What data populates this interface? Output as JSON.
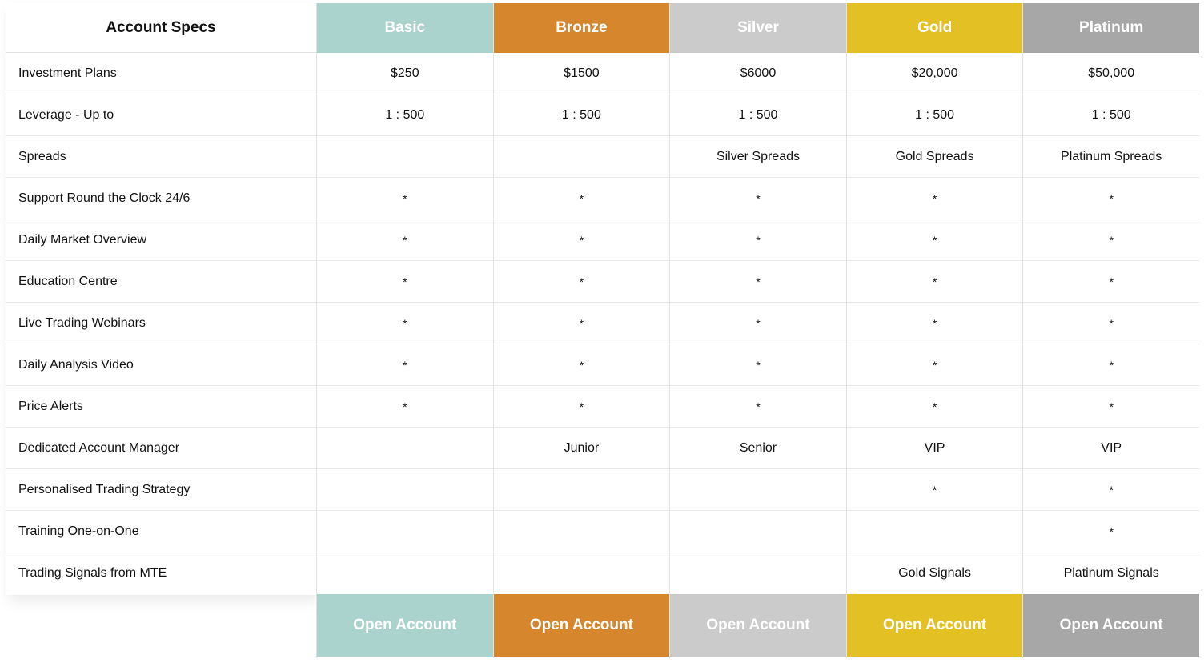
{
  "specs_title": "Account Specs",
  "features": [
    "Investment Plans",
    "Leverage - Up to",
    "Spreads",
    "Support Round the Clock 24/6",
    "Daily Market Overview",
    "Education Centre",
    "Live Trading Webinars",
    "Daily Analysis Video",
    "Price Alerts",
    "Dedicated Account Manager",
    "Personalised Trading Strategy",
    "Training One-on-One",
    "Trading Signals from MTE"
  ],
  "plans": [
    {
      "name": "Basic",
      "color": "#abd3ce",
      "button_label": "Open Account",
      "values": [
        "$250",
        "1 : 500",
        "",
        "*",
        "*",
        "*",
        "*",
        "*",
        "*",
        "",
        "",
        "",
        ""
      ]
    },
    {
      "name": "Bronze",
      "color": "#d6862c",
      "button_label": "Open Account",
      "values": [
        "$1500",
        "1 : 500",
        "",
        "*",
        "*",
        "*",
        "*",
        "*",
        "*",
        "Junior",
        "",
        "",
        ""
      ]
    },
    {
      "name": "Silver",
      "color": "#cbcbcb",
      "button_label": "Open Account",
      "values": [
        "$6000",
        "1 : 500",
        "Silver Spreads",
        "*",
        "*",
        "*",
        "*",
        "*",
        "*",
        "Senior",
        "",
        "",
        ""
      ]
    },
    {
      "name": "Gold",
      "color": "#e3c024",
      "button_label": "Open Account",
      "values": [
        "$20,000",
        "1 : 500",
        "Gold Spreads",
        "*",
        "*",
        "*",
        "*",
        "*",
        "*",
        "VIP",
        "*",
        "",
        "Gold Signals"
      ]
    },
    {
      "name": "Platinum",
      "color": "#a7a7a7",
      "button_label": "Open Account",
      "values": [
        "$50,000",
        "1 : 500",
        "Platinum Spreads",
        "*",
        "*",
        "*",
        "*",
        "*",
        "*",
        "VIP",
        "*",
        "*",
        "Platinum Signals"
      ]
    }
  ]
}
